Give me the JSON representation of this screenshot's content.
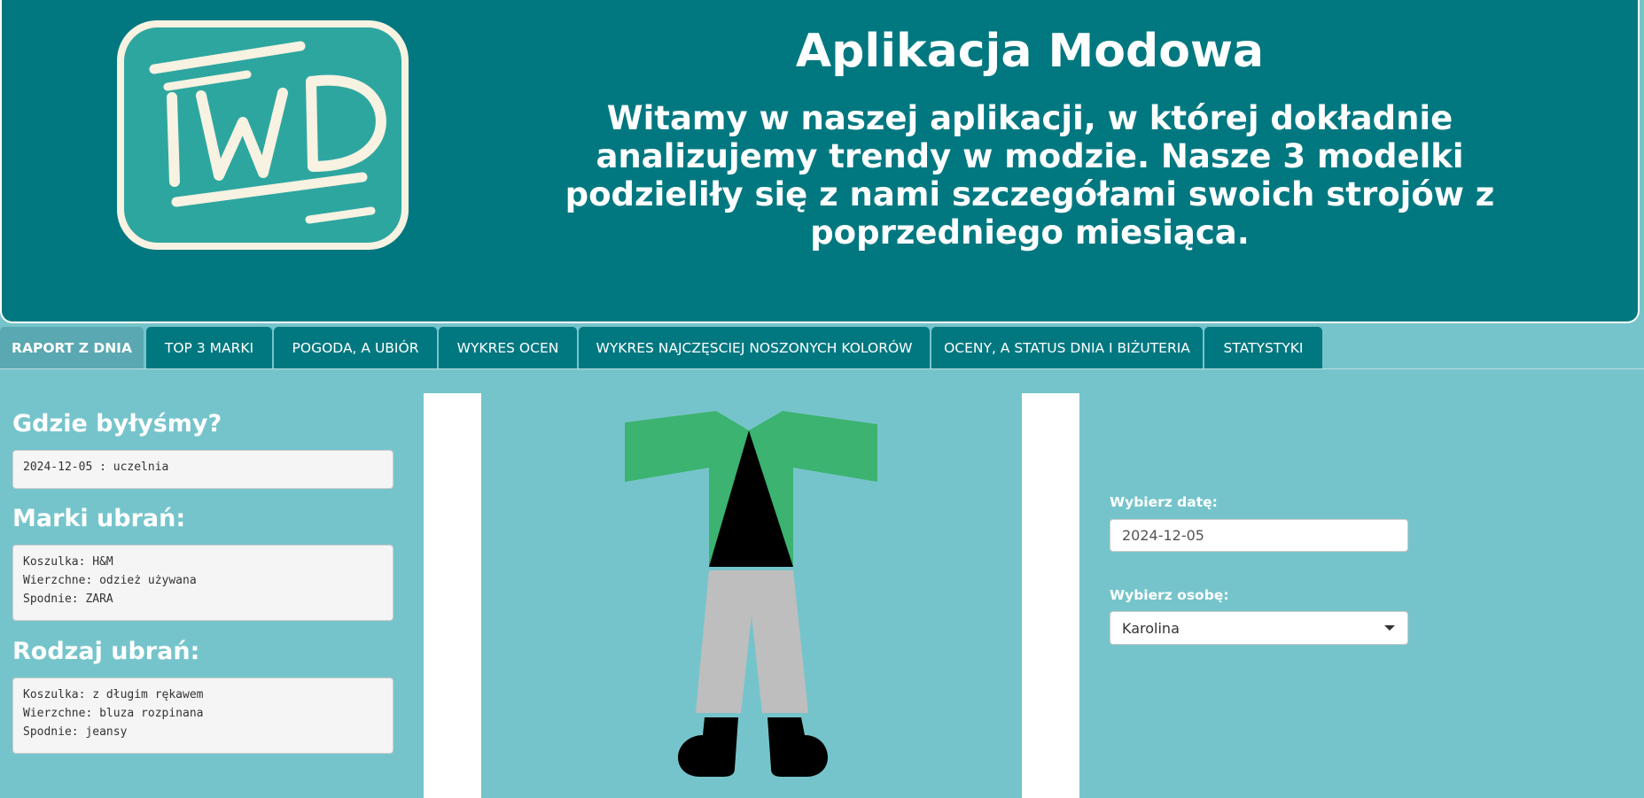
{
  "header": {
    "logo_text": "IWD",
    "title": "Aplikacja Modowa",
    "welcome": "Witamy w naszej aplikacji, w której dokładnie analizujemy trendy w modzie. Nasze 3 modelki podzieliły się z nami szczegółami swoich strojów z poprzedniego miesiąca."
  },
  "tabs": [
    {
      "label": "RAPORT Z DNIA",
      "active": true
    },
    {
      "label": "TOP 3 MARKI",
      "active": false
    },
    {
      "label": "POGODA, A UBIÓR",
      "active": false
    },
    {
      "label": "WYKRES OCEN",
      "active": false
    },
    {
      "label": "WYKRES NAJCZĘSCIEJ NOSZONYCH KOLORÓW",
      "active": false
    },
    {
      "label": "OCENY, A STATUS DNIA I BIŻUTERIA",
      "active": false
    },
    {
      "label": "STATYSTYKI",
      "active": false
    }
  ],
  "report": {
    "where_heading": "Gdzie byłyśmy?",
    "where_value": "2024-12-05 : uczelnia",
    "brands_heading": "Marki ubrań:",
    "brands_lines": [
      "Koszulka: H&M",
      "Wierzchne: odzież używana",
      "Spodnie: ZARA"
    ],
    "types_heading": "Rodzaj ubrań:",
    "types_lines": [
      "Koszulka: z długim rękawem",
      "Wierzchne: bluza rozpinana",
      "Spodnie: jeansy"
    ]
  },
  "outfit_colors": {
    "outerwear": "#3cb371",
    "shirt": "#000000",
    "pants": "#bebebe",
    "shoes": "#000000"
  },
  "controls": {
    "date_label": "Wybierz datę:",
    "date_value": "2024-12-05",
    "person_label": "Wybierz osobę:",
    "person_value": "Karolina"
  },
  "colors": {
    "header_bg": "#017880",
    "page_bg": "#76c4cb",
    "active_tab_bg": "#5aa8b1"
  }
}
